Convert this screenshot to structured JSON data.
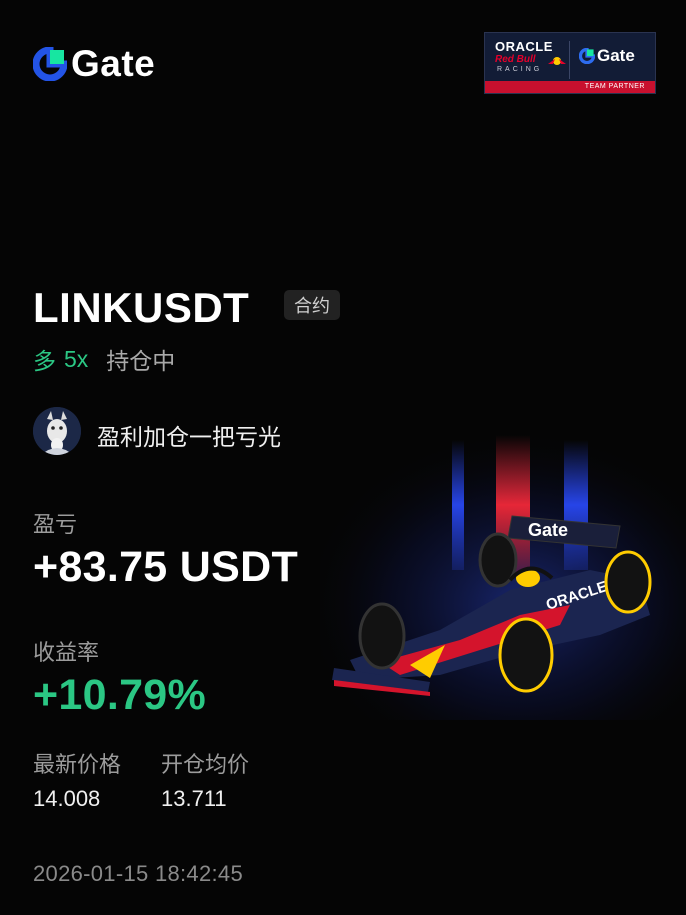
{
  "brand": {
    "name": "Gate",
    "logo_icon": "gate-logo-icon"
  },
  "partner_badge": {
    "line1": "ORACLE",
    "line2": "Red Bull",
    "line3": "RACING",
    "gate": "Gate",
    "footer": "TEAM PARTNER",
    "accent": "#c8102e",
    "bg": "#121c36"
  },
  "position": {
    "symbol": "LINKUSDT",
    "type_badge": "合约",
    "side": "多",
    "leverage": "5x",
    "status": "持仓中"
  },
  "user": {
    "avatar_icon": "goat-avatar-icon",
    "name": "盈利加仓一把亏光"
  },
  "stats": {
    "pnl_label": "盈亏",
    "pnl_value": "+83.75 USDT",
    "roi_label": "收益率",
    "roi_value": "+10.79%",
    "last_price_label": "最新价格",
    "last_price_value": "14.008",
    "entry_price_label": "开仓均价",
    "entry_price_value": "13.711"
  },
  "timestamp": "2026-01-15 18:42:45",
  "car_text": {
    "wing": "Gate",
    "sidepod": "ORACLE"
  },
  "colors": {
    "positive": "#2bc784",
    "background": "#050505",
    "muted": "#9c9c9c"
  }
}
